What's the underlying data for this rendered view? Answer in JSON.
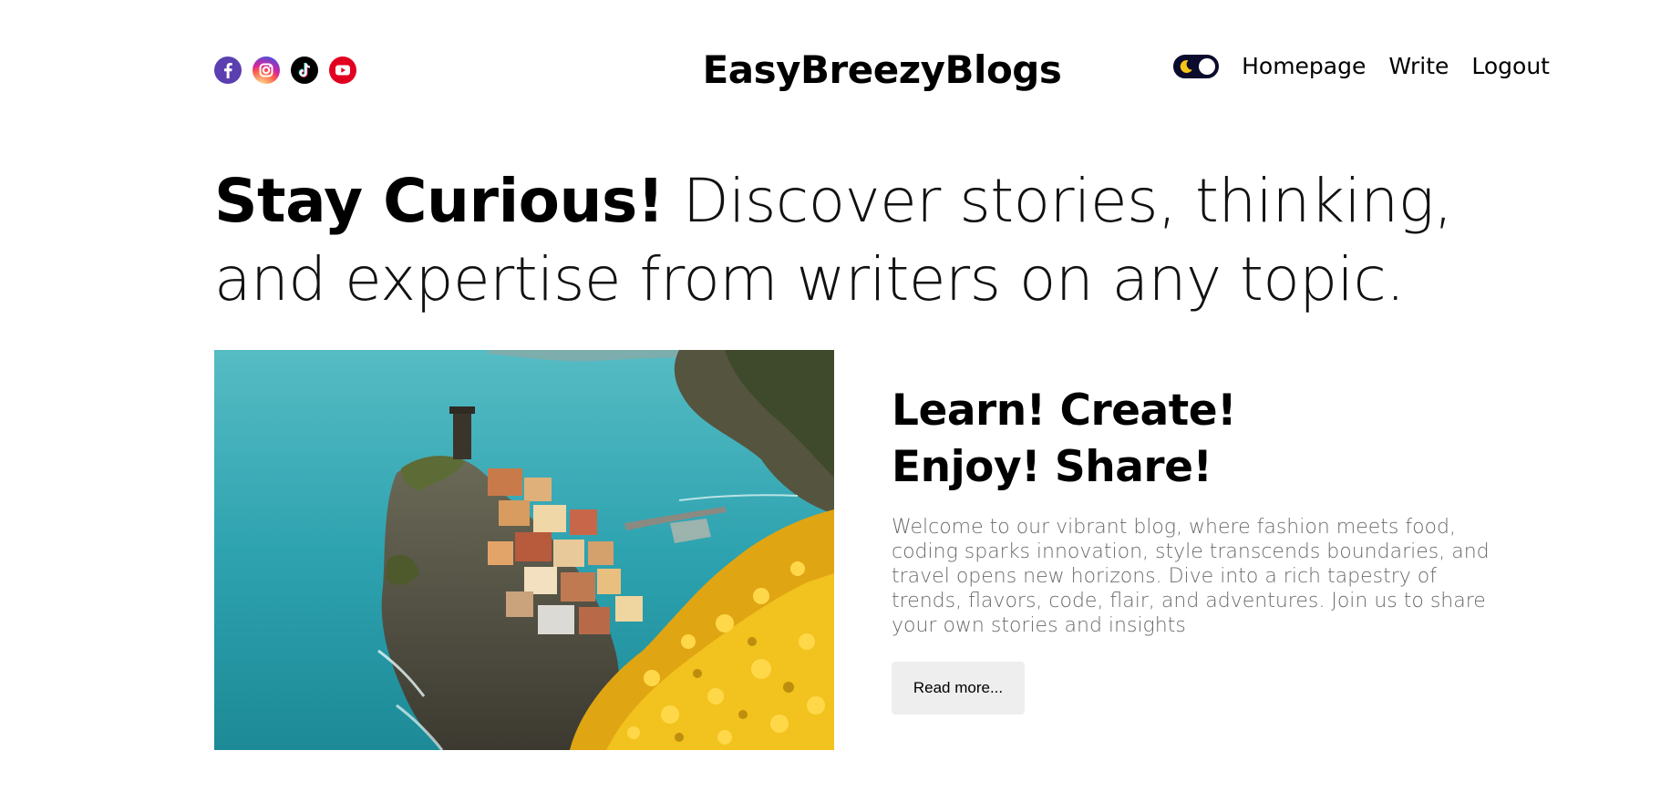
{
  "header": {
    "logo": "EasyBreezyBlogs",
    "socials": [
      {
        "icon": "facebook-icon",
        "color": "#5b3fb0"
      },
      {
        "icon": "instagram-icon",
        "color": "#d6249f"
      },
      {
        "icon": "tiktok-icon",
        "color": "#000000"
      },
      {
        "icon": "youtube-icon",
        "color": "#e1001f"
      }
    ],
    "theme_toggle": {
      "icon": "moon-icon",
      "state": "dark"
    },
    "nav": {
      "homepage": "Homepage",
      "write": "Write",
      "logout": "Logout"
    }
  },
  "hero": {
    "bold": "Stay Curious!",
    "text": " Discover stories, thinking, and expertise from writers on any topic."
  },
  "featured": {
    "title": "Learn! Create! Enjoy! Share!",
    "description": "Welcome to our vibrant blog, where fashion meets food, coding sparks innovation, style transcends boundaries, and travel opens new horizons. Dive into a rich tapestry of trends, flavors, code, flair, and adventures. Join us to share your own stories and insights",
    "button": "Read more..."
  },
  "colors": {
    "background": "#ffffff",
    "text": "#000000",
    "muted": "#6b6b6b",
    "button_bg": "#eeeeee",
    "toggle_bg": "#0b0b2e",
    "toggle_moon": "#f5c518"
  }
}
